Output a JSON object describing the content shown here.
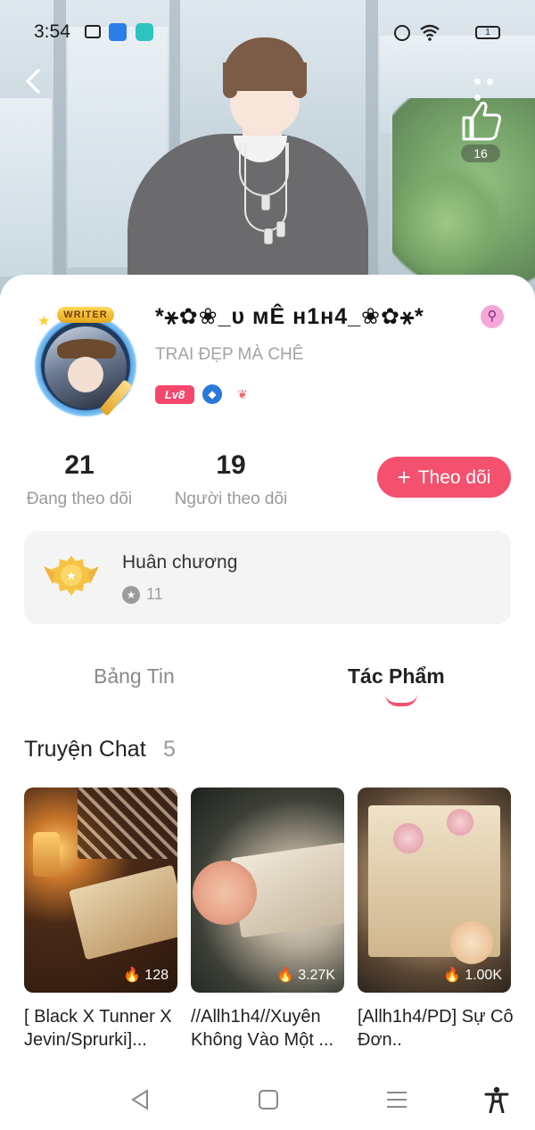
{
  "status_bar": {
    "time": "3:54",
    "battery": "1",
    "icons": [
      "message-icon",
      "novel-toon-icon",
      "chat-app-icon",
      "alarm-icon",
      "wifi-icon",
      "battery-icon"
    ]
  },
  "header": {
    "back_icon": "chevron-left-icon",
    "more_icon": "more-dots-icon",
    "like_icon": "thumbs-up-icon",
    "like_count": "16"
  },
  "profile": {
    "writer_badge": "WRITER",
    "username": "*⚹✿❀_ᴜ ᴍÊ ʜ1ʜ4_❀✿⚹*",
    "gender_icon": "⚲",
    "bio": "TRAI ĐẸP MÀ CHÊ",
    "level": "Lv8",
    "badges": [
      "diamond-badge-icon",
      "wing-badge-icon"
    ]
  },
  "stats": {
    "following_count": "21",
    "following_label": "Đang theo dõi",
    "followers_count": "19",
    "followers_label": "Người theo dõi"
  },
  "follow_button": {
    "plus": "+",
    "label": "Theo dõi"
  },
  "medals": {
    "title": "Huân chương",
    "count": "11"
  },
  "tabs": {
    "news": "Bảng Tin",
    "works": "Tác Phẩm",
    "active": "works"
  },
  "section": {
    "title": "Truyện Chat",
    "count": "5"
  },
  "stories": [
    {
      "title": "[ Black X Tunner X Jevin/Sprurki]...",
      "views": "128"
    },
    {
      "title": "//Allh1h4//Xuyên Không Vào Một ...",
      "views": "3.27K"
    },
    {
      "title": "[Allh1h4/PD] Sự Cô Đơn..",
      "views": "1.00K"
    }
  ],
  "nav": {
    "icons": [
      "nav-back-icon",
      "nav-home-icon",
      "nav-menu-icon",
      "accessibility-icon"
    ]
  },
  "colors": {
    "accent": "#f4516f",
    "level_badge": "#f4486c",
    "muted_text": "#9a9a9a"
  }
}
